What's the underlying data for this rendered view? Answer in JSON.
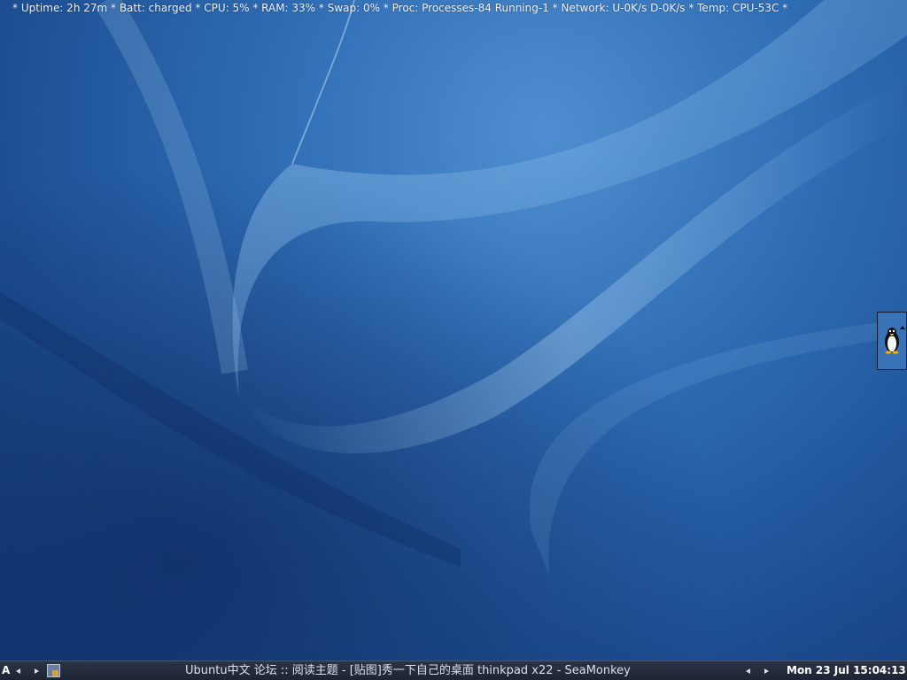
{
  "status_bar": {
    "text": "* Uptime: 2h 27m * Batt: charged * CPU: 5% * RAM: 33% * Swap: 0% * Proc: Processes-84 Running-1 * Network: U-0K/s D-0K/s * Temp: CPU-53C *"
  },
  "tray_applet": {
    "icon": "penguin-icon"
  },
  "taskbar": {
    "desktop_label": "A",
    "task_title": "Ubuntu中文 论坛 :: 阅读主题 - [贴图]秀一下自己的桌面 thinkpad x22 - SeaMonkey",
    "task_icon": "seamonkey-icon",
    "clock": "Mon 23 Jul 15:04:13"
  },
  "colors": {
    "wallpaper_base": "#2f6db5",
    "taskbar_bg": "#1d2433",
    "text": "#e8f0fa"
  }
}
